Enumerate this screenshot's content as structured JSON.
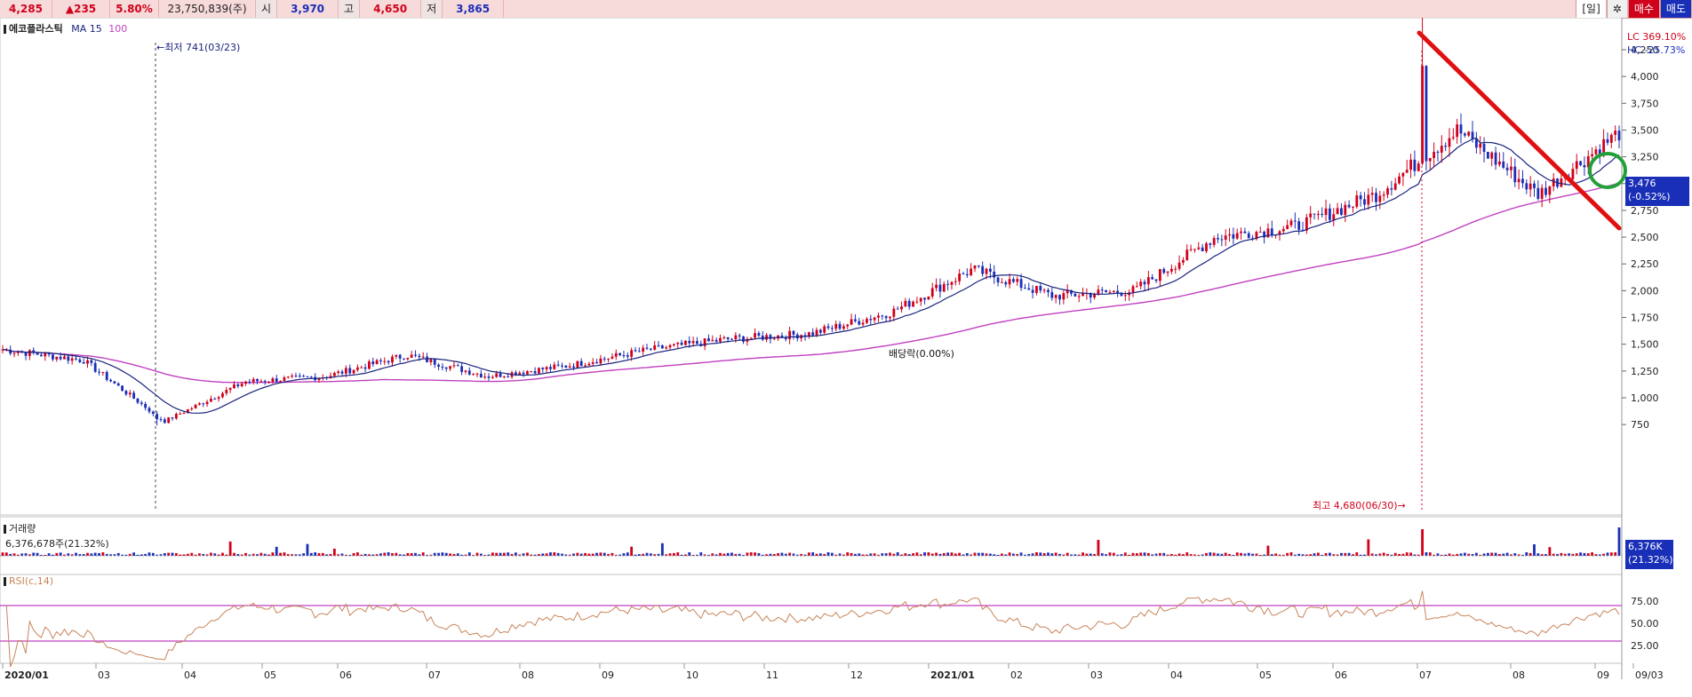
{
  "header": {
    "price": "4,285",
    "change": "▲235",
    "change_pct": "5.80%",
    "volume": "23,750,839(주)",
    "open_label": "시",
    "open": "3,970",
    "high_label": "고",
    "high": "4,650",
    "low_label": "저",
    "low": "3,865",
    "period_label": "[일]",
    "buy_label": "매수",
    "sell_label": "매도"
  },
  "price_panel": {
    "stock_name": "에코플라스틱",
    "ma_label": "MA",
    "ma_short": "15",
    "ma_long": "100",
    "low_annotation": "최저 741(03/23)",
    "high_annotation": "최고 4,680(06/30)",
    "dividend_annotation": "배당락(0.00%)",
    "lc_label": "LC 369.10%",
    "hc_label": "HC -25.73%",
    "current_price_box": "3,476",
    "current_price_pct": "(-0.52%)",
    "y_ticks": [
      "4,250",
      "4,000",
      "3,750",
      "3,500",
      "3,250",
      "3,000",
      "2,750",
      "2,500",
      "2,250",
      "2,000",
      "1,750",
      "1,500",
      "1,250",
      "1,000",
      "750"
    ]
  },
  "volume_panel": {
    "title": "거래량",
    "value": "6,376,678주(21.32%)",
    "box_value": "6,376K",
    "box_pct": "(21.32%)"
  },
  "rsi_panel": {
    "title": "RSI(c,14)",
    "y_ticks": [
      "75.00",
      "50.00",
      "25.00"
    ]
  },
  "x_axis": {
    "labels": [
      "2020/01",
      "03",
      "04",
      "05",
      "06",
      "07",
      "08",
      "09",
      "10",
      "11",
      "12",
      "2021/01",
      "02",
      "03",
      "04",
      "05",
      "06",
      "07",
      "08",
      "09",
      "09/03"
    ]
  },
  "colors": {
    "up": "#d0021b",
    "down": "#1a2fb8",
    "ma15": "#1a237e",
    "ma100": "#c040c0",
    "rsi": "#c8845a",
    "trendline": "#e01010",
    "circle": "#22a03a"
  },
  "chart_data": {
    "type": "candlestick",
    "x_range": [
      "2020/01",
      "2021/09/03"
    ],
    "ylim": [
      750,
      4500
    ],
    "close_path": [
      {
        "month": "2020/01",
        "close": 1450
      },
      {
        "month": "2020/02",
        "close": 1350
      },
      {
        "month": "2020/03",
        "close": 780
      },
      {
        "month": "2020/04",
        "close": 1150
      },
      {
        "month": "2020/05",
        "close": 1200
      },
      {
        "month": "2020/06",
        "close": 1400
      },
      {
        "month": "2020/07",
        "close": 1200
      },
      {
        "month": "2020/08",
        "close": 1300
      },
      {
        "month": "2020/09",
        "close": 1450
      },
      {
        "month": "2020/10",
        "close": 1550
      },
      {
        "month": "2020/11",
        "close": 1600
      },
      {
        "month": "2020/12",
        "close": 1800
      },
      {
        "month": "2021/01",
        "close": 2200
      },
      {
        "month": "2021/02",
        "close": 1950
      },
      {
        "month": "2021/03",
        "close": 2000
      },
      {
        "month": "2021/04",
        "close": 2500
      },
      {
        "month": "2021/05",
        "close": 2600
      },
      {
        "month": "2021/06",
        "close": 2900
      },
      {
        "month": "2021/07",
        "close": 3500
      },
      {
        "month": "2021/08",
        "close": 2900
      },
      {
        "month": "2021/09",
        "close": 3476
      }
    ],
    "annotations": {
      "low": 741,
      "high": 4680
    },
    "rsi_levels": [
      70,
      30
    ]
  }
}
